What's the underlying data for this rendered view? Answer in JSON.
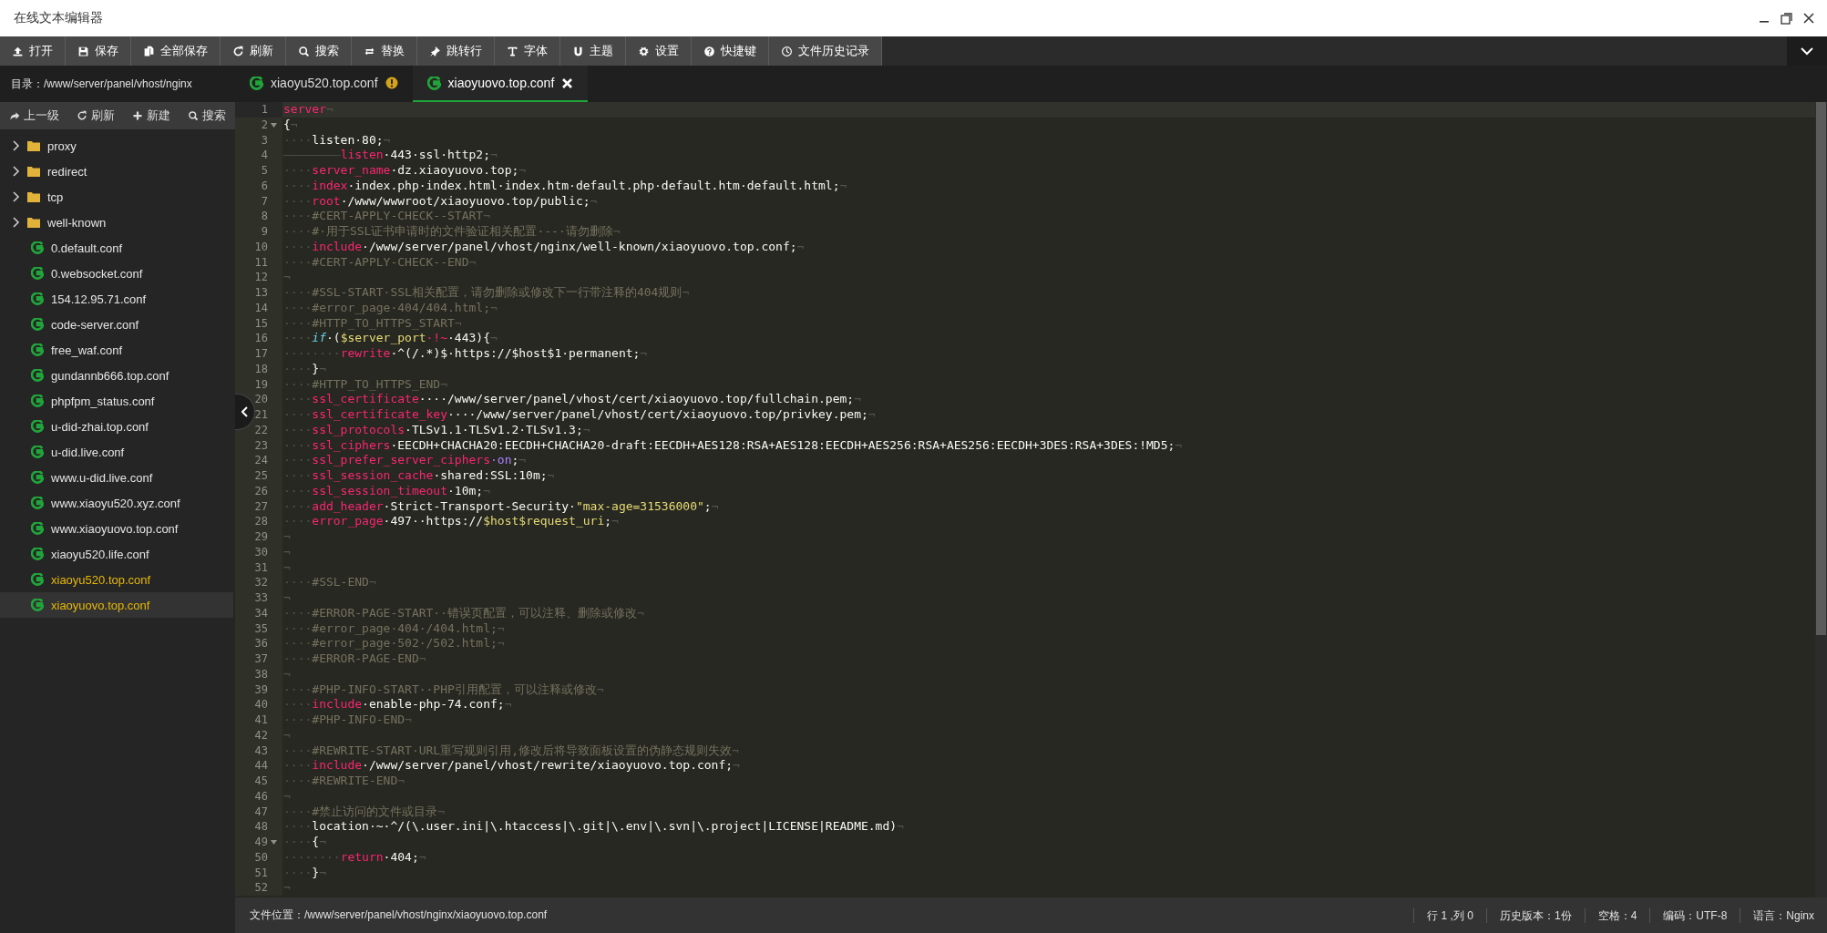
{
  "window": {
    "title": "在线文本编辑器"
  },
  "toolbar": [
    {
      "label": "打开"
    },
    {
      "label": "保存"
    },
    {
      "label": "全部保存"
    },
    {
      "label": "刷新"
    },
    {
      "label": "搜索"
    },
    {
      "label": "替换"
    },
    {
      "label": "跳转行"
    },
    {
      "label": "字体"
    },
    {
      "label": "主题"
    },
    {
      "label": "设置"
    },
    {
      "label": "快捷键"
    },
    {
      "label": "文件历史记录"
    }
  ],
  "sidebar": {
    "directory": "目录：/www/server/panel/vhost/nginx",
    "actions": [
      {
        "label": "上一级"
      },
      {
        "label": "刷新"
      },
      {
        "label": "新建"
      },
      {
        "label": "搜索"
      }
    ],
    "items": [
      {
        "kind": "folder",
        "name": "proxy",
        "expanded": false
      },
      {
        "kind": "folder",
        "name": "redirect",
        "expanded": false
      },
      {
        "kind": "folder",
        "name": "tcp",
        "expanded": false
      },
      {
        "kind": "folder",
        "name": "well-known",
        "expanded": false
      },
      {
        "kind": "file",
        "name": "0.default.conf",
        "open": false,
        "selected": false
      },
      {
        "kind": "file",
        "name": "0.websocket.conf",
        "open": false,
        "selected": false
      },
      {
        "kind": "file",
        "name": "154.12.95.71.conf",
        "open": false,
        "selected": false
      },
      {
        "kind": "file",
        "name": "code-server.conf",
        "open": false,
        "selected": false
      },
      {
        "kind": "file",
        "name": "free_waf.conf",
        "open": false,
        "selected": false
      },
      {
        "kind": "file",
        "name": "gundannb666.top.conf",
        "open": false,
        "selected": false
      },
      {
        "kind": "file",
        "name": "phpfpm_status.conf",
        "open": false,
        "selected": false
      },
      {
        "kind": "file",
        "name": "u-did-zhai.top.conf",
        "open": false,
        "selected": false
      },
      {
        "kind": "file",
        "name": "u-did.live.conf",
        "open": false,
        "selected": false
      },
      {
        "kind": "file",
        "name": "www.u-did.live.conf",
        "open": false,
        "selected": false
      },
      {
        "kind": "file",
        "name": "www.xiaoyu520.xyz.conf",
        "open": false,
        "selected": false
      },
      {
        "kind": "file",
        "name": "www.xiaoyuovo.top.conf",
        "open": false,
        "selected": false
      },
      {
        "kind": "file",
        "name": "xiaoyu520.life.conf",
        "open": false,
        "selected": false
      },
      {
        "kind": "file",
        "name": "xiaoyu520.top.conf",
        "open": true,
        "selected": false
      },
      {
        "kind": "file",
        "name": "xiaoyuovo.top.conf",
        "open": true,
        "selected": true
      }
    ]
  },
  "tabs": [
    {
      "label": "xiaoyu520.top.conf",
      "selected": false,
      "modified": true
    },
    {
      "label": "xiaoyuovo.top.conf",
      "selected": true,
      "modified": false
    }
  ],
  "editor": {
    "lines": [
      {
        "number": "1",
        "current": true,
        "fold": false,
        "tokens": [
          {
            "kind": "kw",
            "text": "server"
          },
          {
            "kind": "ws",
            "text": "¬"
          }
        ]
      },
      {
        "number": "2",
        "current": false,
        "fold": true,
        "tokens": [
          {
            "kind": "tx",
            "text": "{"
          },
          {
            "kind": "ws",
            "text": "¬"
          }
        ]
      },
      {
        "number": "3",
        "current": false,
        "fold": false,
        "tokens": [
          {
            "kind": "ws",
            "text": "····"
          },
          {
            "kind": "tx",
            "text": "listen·80;"
          },
          {
            "kind": "ws",
            "text": "¬"
          }
        ]
      },
      {
        "number": "4",
        "current": false,
        "fold": false,
        "tokens": [
          {
            "kind": "ws",
            "text": "————————"
          },
          {
            "kind": "kw",
            "text": "listen"
          },
          {
            "kind": "tx",
            "text": "·443·ssl·http2;"
          },
          {
            "kind": "ws",
            "text": "¬"
          }
        ]
      },
      {
        "number": "5",
        "current": false,
        "fold": false,
        "tokens": [
          {
            "kind": "ws",
            "text": "····"
          },
          {
            "kind": "kw",
            "text": "server_name"
          },
          {
            "kind": "tx",
            "text": "·dz.xiaoyuovo.top;"
          },
          {
            "kind": "ws",
            "text": "¬"
          }
        ]
      },
      {
        "number": "6",
        "current": false,
        "fold": false,
        "tokens": [
          {
            "kind": "ws",
            "text": "····"
          },
          {
            "kind": "kw",
            "text": "index"
          },
          {
            "kind": "tx",
            "text": "·index.php·index.html·index.htm·default.php·default.htm·default.html;"
          },
          {
            "kind": "ws",
            "text": "¬"
          }
        ]
      },
      {
        "number": "7",
        "current": false,
        "fold": false,
        "tokens": [
          {
            "kind": "ws",
            "text": "····"
          },
          {
            "kind": "kw",
            "text": "root"
          },
          {
            "kind": "tx",
            "text": "·/www/wwwroot/xiaoyuovo.top/public;"
          },
          {
            "kind": "ws",
            "text": "¬"
          }
        ]
      },
      {
        "number": "8",
        "current": false,
        "fold": false,
        "tokens": [
          {
            "kind": "ws",
            "text": "····"
          },
          {
            "kind": "cm",
            "text": "#CERT-APPLY-CHECK--START"
          },
          {
            "kind": "ws",
            "text": "¬"
          }
        ]
      },
      {
        "number": "9",
        "current": false,
        "fold": false,
        "tokens": [
          {
            "kind": "ws",
            "text": "····"
          },
          {
            "kind": "cm",
            "text": "#·用于SSL证书申请时的文件验证相关配置·--·请勿删除"
          },
          {
            "kind": "ws",
            "text": "¬"
          }
        ]
      },
      {
        "number": "10",
        "current": false,
        "fold": false,
        "tokens": [
          {
            "kind": "ws",
            "text": "····"
          },
          {
            "kind": "kw",
            "text": "include"
          },
          {
            "kind": "tx",
            "text": "·/www/server/panel/vhost/nginx/well-known/xiaoyuovo.top.conf;"
          },
          {
            "kind": "ws",
            "text": "¬"
          }
        ]
      },
      {
        "number": "11",
        "current": false,
        "fold": false,
        "tokens": [
          {
            "kind": "ws",
            "text": "····"
          },
          {
            "kind": "cm",
            "text": "#CERT-APPLY-CHECK--END"
          },
          {
            "kind": "ws",
            "text": "¬"
          }
        ]
      },
      {
        "number": "12",
        "current": false,
        "fold": false,
        "tokens": [
          {
            "kind": "ws",
            "text": "¬"
          }
        ]
      },
      {
        "number": "13",
        "current": false,
        "fold": false,
        "tokens": [
          {
            "kind": "ws",
            "text": "····"
          },
          {
            "kind": "cm",
            "text": "#SSL-START·SSL相关配置，请勿删除或修改下一行带注释的404规则"
          },
          {
            "kind": "ws",
            "text": "¬"
          }
        ]
      },
      {
        "number": "14",
        "current": false,
        "fold": false,
        "tokens": [
          {
            "kind": "ws",
            "text": "····"
          },
          {
            "kind": "cm",
            "text": "#error_page·404/404.html;"
          },
          {
            "kind": "ws",
            "text": "¬"
          }
        ]
      },
      {
        "number": "15",
        "current": false,
        "fold": false,
        "tokens": [
          {
            "kind": "ws",
            "text": "····"
          },
          {
            "kind": "cm",
            "text": "#HTTP_TO_HTTPS_START"
          },
          {
            "kind": "ws",
            "text": "¬"
          }
        ]
      },
      {
        "number": "16",
        "current": false,
        "fold": false,
        "tokens": [
          {
            "kind": "ws",
            "text": "····"
          },
          {
            "kind": "fn",
            "text": "if"
          },
          {
            "kind": "tx",
            "text": "·("
          },
          {
            "kind": "vr",
            "text": "$server_port"
          },
          {
            "kind": "kw",
            "text": "·!~"
          },
          {
            "kind": "tx",
            "text": "·443){"
          },
          {
            "kind": "ws",
            "text": "¬"
          }
        ]
      },
      {
        "number": "17",
        "current": false,
        "fold": false,
        "tokens": [
          {
            "kind": "ws",
            "text": "········"
          },
          {
            "kind": "kw",
            "text": "rewrite"
          },
          {
            "kind": "tx",
            "text": "·^(/.*)$·https://$host$1·permanent;"
          },
          {
            "kind": "ws",
            "text": "¬"
          }
        ]
      },
      {
        "number": "18",
        "current": false,
        "fold": false,
        "tokens": [
          {
            "kind": "ws",
            "text": "····"
          },
          {
            "kind": "tx",
            "text": "}"
          },
          {
            "kind": "ws",
            "text": "¬"
          }
        ]
      },
      {
        "number": "19",
        "current": false,
        "fold": false,
        "tokens": [
          {
            "kind": "ws",
            "text": "····"
          },
          {
            "kind": "cm",
            "text": "#HTTP_TO_HTTPS_END"
          },
          {
            "kind": "ws",
            "text": "¬"
          }
        ]
      },
      {
        "number": "20",
        "current": false,
        "fold": false,
        "tokens": [
          {
            "kind": "ws",
            "text": "····"
          },
          {
            "kind": "kw",
            "text": "ssl_certificate"
          },
          {
            "kind": "tx",
            "text": "····/www/server/panel/vhost/cert/xiaoyuovo.top/fullchain.pem;"
          },
          {
            "kind": "ws",
            "text": "¬"
          }
        ]
      },
      {
        "number": "21",
        "current": false,
        "fold": false,
        "tokens": [
          {
            "kind": "ws",
            "text": "····"
          },
          {
            "kind": "kw",
            "text": "ssl_certificate_key"
          },
          {
            "kind": "tx",
            "text": "····/www/server/panel/vhost/cert/xiaoyuovo.top/privkey.pem;"
          },
          {
            "kind": "ws",
            "text": "¬"
          }
        ]
      },
      {
        "number": "22",
        "current": false,
        "fold": false,
        "tokens": [
          {
            "kind": "ws",
            "text": "····"
          },
          {
            "kind": "kw",
            "text": "ssl_protocols"
          },
          {
            "kind": "tx",
            "text": "·TLSv1.1·TLSv1.2·TLSv1.3;"
          },
          {
            "kind": "ws",
            "text": "¬"
          }
        ]
      },
      {
        "number": "23",
        "current": false,
        "fold": false,
        "tokens": [
          {
            "kind": "ws",
            "text": "····"
          },
          {
            "kind": "kw",
            "text": "ssl_ciphers"
          },
          {
            "kind": "tx",
            "text": "·EECDH+CHACHA20:EECDH+CHACHA20-draft:EECDH+AES128:RSA+AES128:EECDH+AES256:RSA+AES256:EECDH+3DES:RSA+3DES:!MD5;"
          },
          {
            "kind": "ws",
            "text": "¬"
          }
        ]
      },
      {
        "number": "24",
        "current": false,
        "fold": false,
        "tokens": [
          {
            "kind": "ws",
            "text": "····"
          },
          {
            "kind": "kw",
            "text": "ssl_prefer_server_ciphers"
          },
          {
            "kind": "nu",
            "text": "·on"
          },
          {
            "kind": "tx",
            "text": ";"
          },
          {
            "kind": "ws",
            "text": "¬"
          }
        ]
      },
      {
        "number": "25",
        "current": false,
        "fold": false,
        "tokens": [
          {
            "kind": "ws",
            "text": "····"
          },
          {
            "kind": "kw",
            "text": "ssl_session_cache"
          },
          {
            "kind": "tx",
            "text": "·shared:SSL:10m;"
          },
          {
            "kind": "ws",
            "text": "¬"
          }
        ]
      },
      {
        "number": "26",
        "current": false,
        "fold": false,
        "tokens": [
          {
            "kind": "ws",
            "text": "····"
          },
          {
            "kind": "kw",
            "text": "ssl_session_timeout"
          },
          {
            "kind": "tx",
            "text": "·10m;"
          },
          {
            "kind": "ws",
            "text": "¬"
          }
        ]
      },
      {
        "number": "27",
        "current": false,
        "fold": false,
        "tokens": [
          {
            "kind": "ws",
            "text": "····"
          },
          {
            "kind": "kw",
            "text": "add_header"
          },
          {
            "kind": "tx",
            "text": "·Strict-Transport-Security·"
          },
          {
            "kind": "st",
            "text": "\"max-age=31536000\""
          },
          {
            "kind": "tx",
            "text": ";"
          },
          {
            "kind": "ws",
            "text": "¬"
          }
        ]
      },
      {
        "number": "28",
        "current": false,
        "fold": false,
        "tokens": [
          {
            "kind": "ws",
            "text": "····"
          },
          {
            "kind": "kw",
            "text": "error_page"
          },
          {
            "kind": "tx",
            "text": "·497··https://"
          },
          {
            "kind": "vr",
            "text": "$host$request_uri"
          },
          {
            "kind": "tx",
            "text": ";"
          },
          {
            "kind": "ws",
            "text": "¬"
          }
        ]
      },
      {
        "number": "29",
        "current": false,
        "fold": false,
        "tokens": [
          {
            "kind": "ws",
            "text": "¬"
          }
        ]
      },
      {
        "number": "30",
        "current": false,
        "fold": false,
        "tokens": [
          {
            "kind": "ws",
            "text": "¬"
          }
        ]
      },
      {
        "number": "31",
        "current": false,
        "fold": false,
        "tokens": [
          {
            "kind": "ws",
            "text": "¬"
          }
        ]
      },
      {
        "number": "32",
        "current": false,
        "fold": false,
        "tokens": [
          {
            "kind": "ws",
            "text": "····"
          },
          {
            "kind": "cm",
            "text": "#SSL-END"
          },
          {
            "kind": "ws",
            "text": "¬"
          }
        ]
      },
      {
        "number": "33",
        "current": false,
        "fold": false,
        "tokens": [
          {
            "kind": "ws",
            "text": "¬"
          }
        ]
      },
      {
        "number": "34",
        "current": false,
        "fold": false,
        "tokens": [
          {
            "kind": "ws",
            "text": "····"
          },
          {
            "kind": "cm",
            "text": "#ERROR-PAGE-START··错误页配置，可以注释、删除或修改"
          },
          {
            "kind": "ws",
            "text": "¬"
          }
        ]
      },
      {
        "number": "35",
        "current": false,
        "fold": false,
        "tokens": [
          {
            "kind": "ws",
            "text": "····"
          },
          {
            "kind": "cm",
            "text": "#error_page·404·/404.html;"
          },
          {
            "kind": "ws",
            "text": "¬"
          }
        ]
      },
      {
        "number": "36",
        "current": false,
        "fold": false,
        "tokens": [
          {
            "kind": "ws",
            "text": "····"
          },
          {
            "kind": "cm",
            "text": "#error_page·502·/502.html;"
          },
          {
            "kind": "ws",
            "text": "¬"
          }
        ]
      },
      {
        "number": "37",
        "current": false,
        "fold": false,
        "tokens": [
          {
            "kind": "ws",
            "text": "····"
          },
          {
            "kind": "cm",
            "text": "#ERROR-PAGE-END"
          },
          {
            "kind": "ws",
            "text": "¬"
          }
        ]
      },
      {
        "number": "38",
        "current": false,
        "fold": false,
        "tokens": [
          {
            "kind": "ws",
            "text": "¬"
          }
        ]
      },
      {
        "number": "39",
        "current": false,
        "fold": false,
        "tokens": [
          {
            "kind": "ws",
            "text": "····"
          },
          {
            "kind": "cm",
            "text": "#PHP-INFO-START··PHP引用配置，可以注释或修改"
          },
          {
            "kind": "ws",
            "text": "¬"
          }
        ]
      },
      {
        "number": "40",
        "current": false,
        "fold": false,
        "tokens": [
          {
            "kind": "ws",
            "text": "····"
          },
          {
            "kind": "kw",
            "text": "include"
          },
          {
            "kind": "tx",
            "text": "·enable-php-74.conf;"
          },
          {
            "kind": "ws",
            "text": "¬"
          }
        ]
      },
      {
        "number": "41",
        "current": false,
        "fold": false,
        "tokens": [
          {
            "kind": "ws",
            "text": "····"
          },
          {
            "kind": "cm",
            "text": "#PHP-INFO-END"
          },
          {
            "kind": "ws",
            "text": "¬"
          }
        ]
      },
      {
        "number": "42",
        "current": false,
        "fold": false,
        "tokens": [
          {
            "kind": "ws",
            "text": "¬"
          }
        ]
      },
      {
        "number": "43",
        "current": false,
        "fold": false,
        "tokens": [
          {
            "kind": "ws",
            "text": "····"
          },
          {
            "kind": "cm",
            "text": "#REWRITE-START·URL重写规则引用,修改后将导致面板设置的伪静态规则失效"
          },
          {
            "kind": "ws",
            "text": "¬"
          }
        ]
      },
      {
        "number": "44",
        "current": false,
        "fold": false,
        "tokens": [
          {
            "kind": "ws",
            "text": "····"
          },
          {
            "kind": "kw",
            "text": "include"
          },
          {
            "kind": "tx",
            "text": "·/www/server/panel/vhost/rewrite/xiaoyuovo.top.conf;"
          },
          {
            "kind": "ws",
            "text": "¬"
          }
        ]
      },
      {
        "number": "45",
        "current": false,
        "fold": false,
        "tokens": [
          {
            "kind": "ws",
            "text": "····"
          },
          {
            "kind": "cm",
            "text": "#REWRITE-END"
          },
          {
            "kind": "ws",
            "text": "¬"
          }
        ]
      },
      {
        "number": "46",
        "current": false,
        "fold": false,
        "tokens": [
          {
            "kind": "ws",
            "text": "¬"
          }
        ]
      },
      {
        "number": "47",
        "current": false,
        "fold": false,
        "tokens": [
          {
            "kind": "ws",
            "text": "····"
          },
          {
            "kind": "cm",
            "text": "#禁止访问的文件或目录"
          },
          {
            "kind": "ws",
            "text": "¬"
          }
        ]
      },
      {
        "number": "48",
        "current": false,
        "fold": false,
        "tokens": [
          {
            "kind": "ws",
            "text": "····"
          },
          {
            "kind": "tx",
            "text": "location·~·^/(\\.user.ini|\\.htaccess|\\.git|\\.env|\\.svn|\\.project|LICENSE|README.md)"
          },
          {
            "kind": "ws",
            "text": "¬"
          }
        ]
      },
      {
        "number": "49",
        "current": false,
        "fold": true,
        "tokens": [
          {
            "kind": "ws",
            "text": "····"
          },
          {
            "kind": "tx",
            "text": "{"
          },
          {
            "kind": "ws",
            "text": "¬"
          }
        ]
      },
      {
        "number": "50",
        "current": false,
        "fold": false,
        "tokens": [
          {
            "kind": "ws",
            "text": "········"
          },
          {
            "kind": "kw",
            "text": "return"
          },
          {
            "kind": "tx",
            "text": "·404;"
          },
          {
            "kind": "ws",
            "text": "¬"
          }
        ]
      },
      {
        "number": "51",
        "current": false,
        "fold": false,
        "tokens": [
          {
            "kind": "ws",
            "text": "····"
          },
          {
            "kind": "tx",
            "text": "}"
          },
          {
            "kind": "ws",
            "text": "¬"
          }
        ]
      },
      {
        "number": "52",
        "current": false,
        "fold": false,
        "tokens": [
          {
            "kind": "ws",
            "text": "¬"
          }
        ]
      }
    ]
  },
  "status_bar": {
    "path": "文件位置：/www/server/panel/vhost/nginx/xiaoyuovo.top.conf",
    "items": [
      {
        "text": "行 1 ,列 0"
      },
      {
        "text": "历史版本：1份"
      },
      {
        "text": "空格：4"
      },
      {
        "text": "编码：UTF-8"
      },
      {
        "text": "语言：Nginx"
      }
    ]
  }
}
